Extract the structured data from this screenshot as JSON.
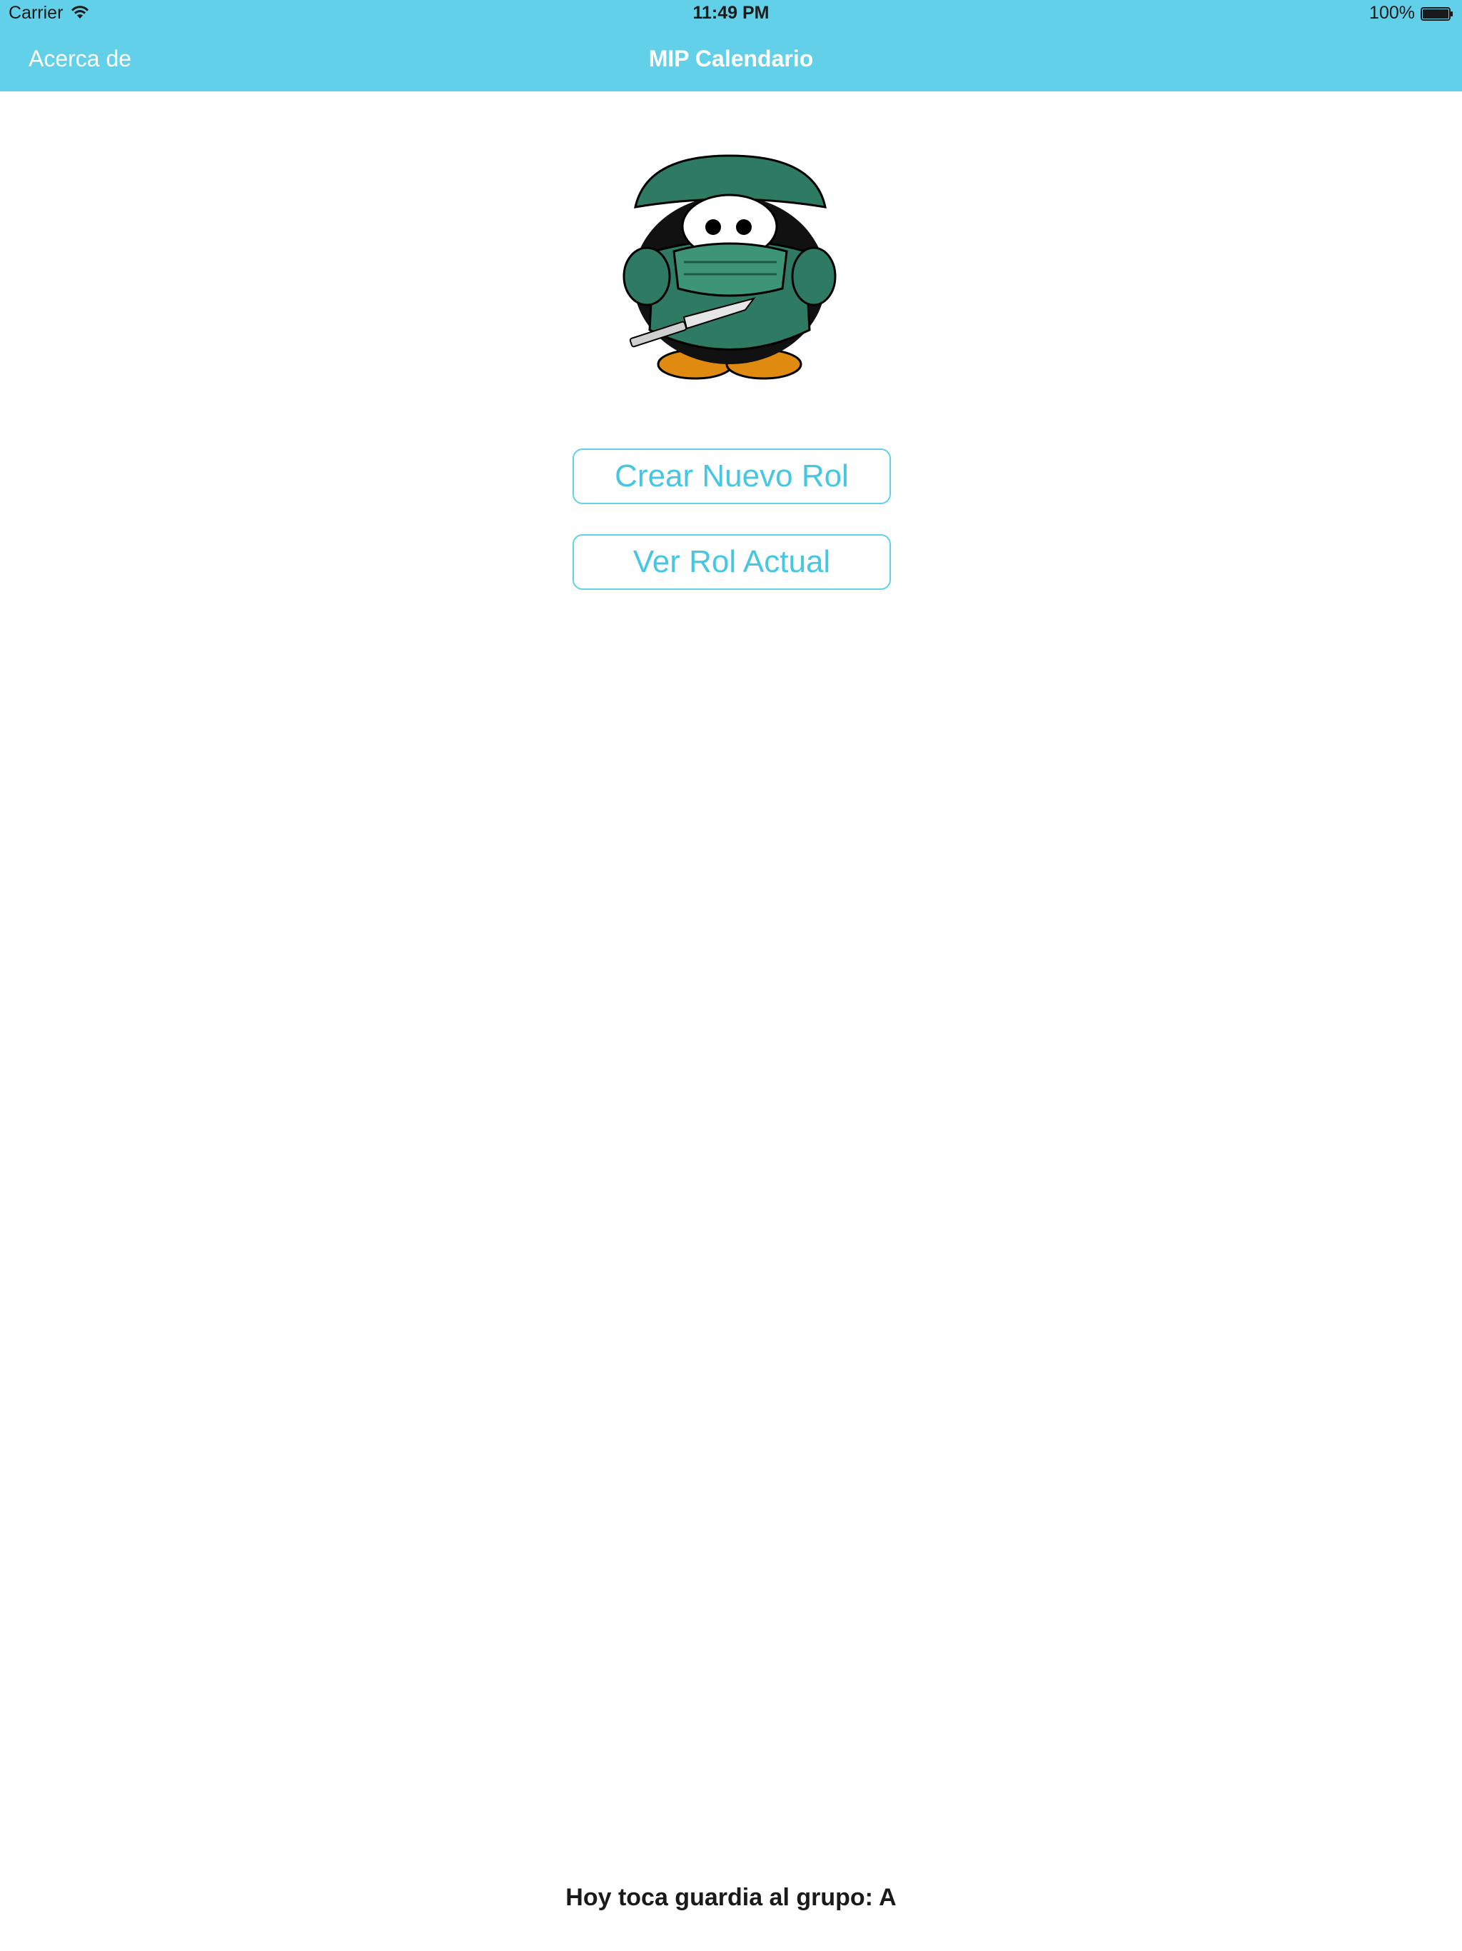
{
  "status_bar": {
    "carrier": "Carrier",
    "time": "11:49 PM",
    "battery": "100%",
    "icons": [
      "wifi-icon",
      "battery-icon"
    ]
  },
  "nav": {
    "left_label": "Acerca de",
    "title": "MIP Calendario"
  },
  "mascot": {
    "icon": "penguin-surgeon-icon"
  },
  "buttons": {
    "create_label": "Crear Nuevo Rol",
    "view_label": "Ver Rol Actual"
  },
  "footer": {
    "text": "Hoy toca guardia al grupo: A"
  },
  "colors": {
    "accent": "#62D0E8",
    "button_text": "#46C6E2",
    "background": "#ffffff"
  }
}
